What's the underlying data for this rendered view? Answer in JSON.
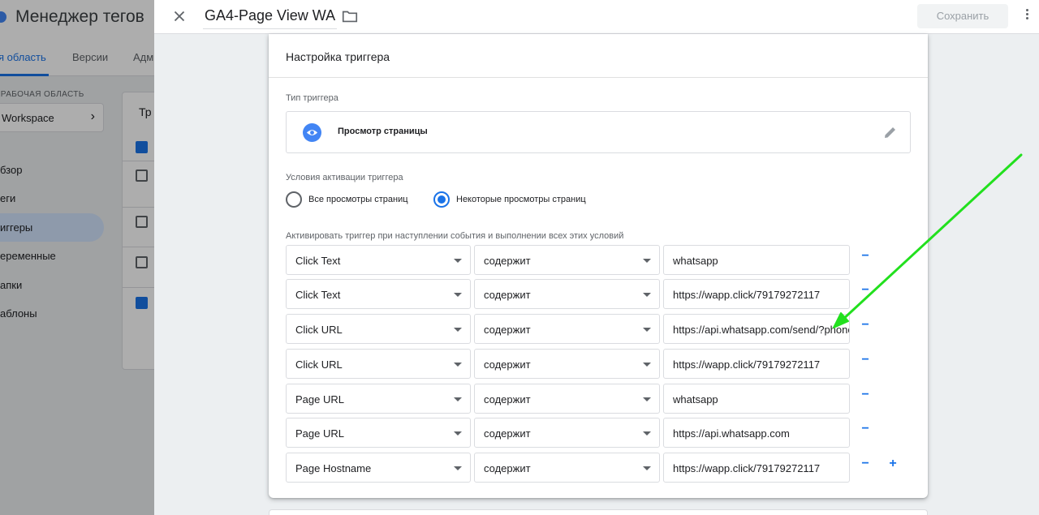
{
  "app": {
    "title": "Менеджер тегов",
    "tabs": [
      "я область",
      "Версии",
      "Адм"
    ],
    "workspace_label": "Я РАБОЧАЯ ОБЛАСТЬ",
    "workspace_name": "Workspace",
    "nav": [
      "Обзор",
      "Теги",
      "Триггеры",
      "Переменные",
      "Папки",
      "Шаблоны"
    ],
    "nav_display": [
      "бзор",
      "еги",
      "иггеры",
      "еременные",
      "апки",
      "аблоны"
    ],
    "active_nav": "Триггеры",
    "panel_title": "Тр"
  },
  "sheet": {
    "name": "GA4-Page View WA",
    "save_label": "Сохранить"
  },
  "card": {
    "title": "Настройка триггера",
    "type_label": "Тип триггера",
    "type_name": "Просмотр страницы",
    "activation_label": "Условия активации триггера",
    "radios": [
      {
        "label": "Все просмотры страниц",
        "checked": false
      },
      {
        "label": "Некоторые просмотры страниц",
        "checked": true
      }
    ],
    "conditions_label": "Активировать триггер при наступлении события и выполнении всех этих условий",
    "conditions": [
      {
        "variable": "Click Text",
        "operator": "содержит",
        "value": "whatsapp"
      },
      {
        "variable": "Click Text",
        "operator": "содержит",
        "value": "https://wapp.click/79179272117"
      },
      {
        "variable": "Click URL",
        "operator": "содержит",
        "value": "https://api.whatsapp.com/send/?phone"
      },
      {
        "variable": "Click URL",
        "operator": "содержит",
        "value": "https://wapp.click/79179272117"
      },
      {
        "variable": "Page URL",
        "operator": "содержит",
        "value": "whatsapp"
      },
      {
        "variable": "Page URL",
        "operator": "содержит",
        "value": "https://api.whatsapp.com"
      },
      {
        "variable": "Page Hostname",
        "operator": "содержит",
        "value": "https://wapp.click/79179272117"
      }
    ],
    "minus_symbol": "−",
    "plus_symbol": "+"
  },
  "icons": {
    "close": "close-icon",
    "folder": "folder-icon",
    "more": "more-vert-icon",
    "eye": "eye-icon",
    "edit": "pencil-icon",
    "chevron": "chevron-right-icon",
    "dropdown": "dropdown-arrow-icon"
  },
  "colors": {
    "accent": "#1a73e8",
    "annotation_arrow": "#22e01e",
    "overlay": "rgba(0,0,0,0.32)"
  }
}
